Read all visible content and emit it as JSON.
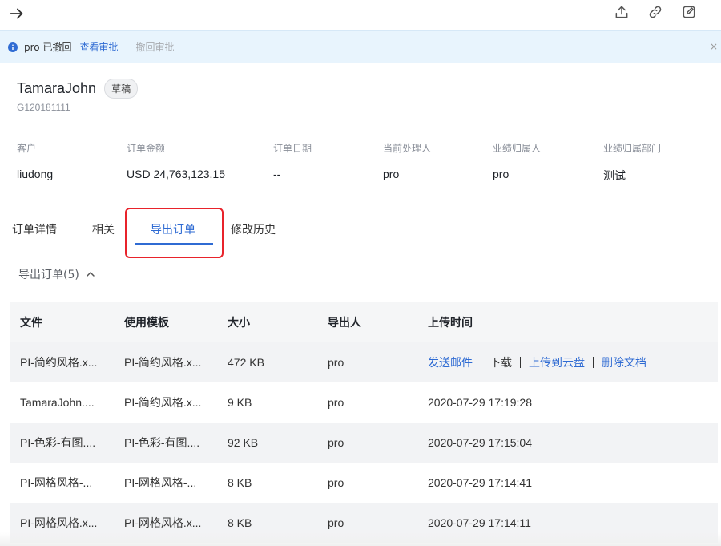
{
  "header": {
    "back_icon": "arrow-right-icon",
    "actions": [
      "share-icon",
      "link-icon",
      "edit-icon"
    ]
  },
  "notice": {
    "message": "pro 已撤回",
    "view_link": "查看审批",
    "withdraw_link": "撤回审批",
    "close": "×"
  },
  "record": {
    "title": "TamaraJohn",
    "status": "草稿",
    "code": "G120181111"
  },
  "fields": [
    {
      "label": "客户",
      "value": "liudong"
    },
    {
      "label": "订单金额",
      "value": "USD 24,763,123.15"
    },
    {
      "label": "订单日期",
      "value": "--"
    },
    {
      "label": "当前处理人",
      "value": "pro"
    },
    {
      "label": "业绩归属人",
      "value": "pro"
    },
    {
      "label": "业绩归属部门",
      "value": "测试"
    }
  ],
  "tabs": [
    {
      "label": "订单详情"
    },
    {
      "label": "相关"
    },
    {
      "label": "导出订单"
    },
    {
      "label": "修改历史"
    }
  ],
  "active_tab": "导出订单",
  "section": {
    "title": "导出订单(5)"
  },
  "table": {
    "columns": [
      "文件",
      "使用模板",
      "大小",
      "导出人",
      "上传时间"
    ],
    "rows": [
      {
        "file": "PI-简约风格.x...",
        "template": "PI-简约风格.x...",
        "size": "472 KB",
        "user": "pro",
        "time": ""
      },
      {
        "file": "TamaraJohn....",
        "template": "PI-简约风格.x...",
        "size": "9 KB",
        "user": "pro",
        "time": "2020-07-29 17:19:28"
      },
      {
        "file": "PI-色彩-有图....",
        "template": "PI-色彩-有图....",
        "size": "92 KB",
        "user": "pro",
        "time": "2020-07-29 17:15:04"
      },
      {
        "file": "PI-网格风格-...",
        "template": "PI-网格风格-...",
        "size": "8 KB",
        "user": "pro",
        "time": "2020-07-29 17:14:41"
      },
      {
        "file": "PI-网格风格.x...",
        "template": "PI-网格风格.x...",
        "size": "8 KB",
        "user": "pro",
        "time": "2020-07-29 17:14:11"
      }
    ],
    "row_actions": {
      "send_email": "发送邮件",
      "download": "下载",
      "upload_cloud": "上传到云盘",
      "delete": "删除文档"
    }
  },
  "colors": {
    "accent": "#2f6bd3",
    "highlight": "#e8232b",
    "notice_bg": "#e8f4fd"
  }
}
